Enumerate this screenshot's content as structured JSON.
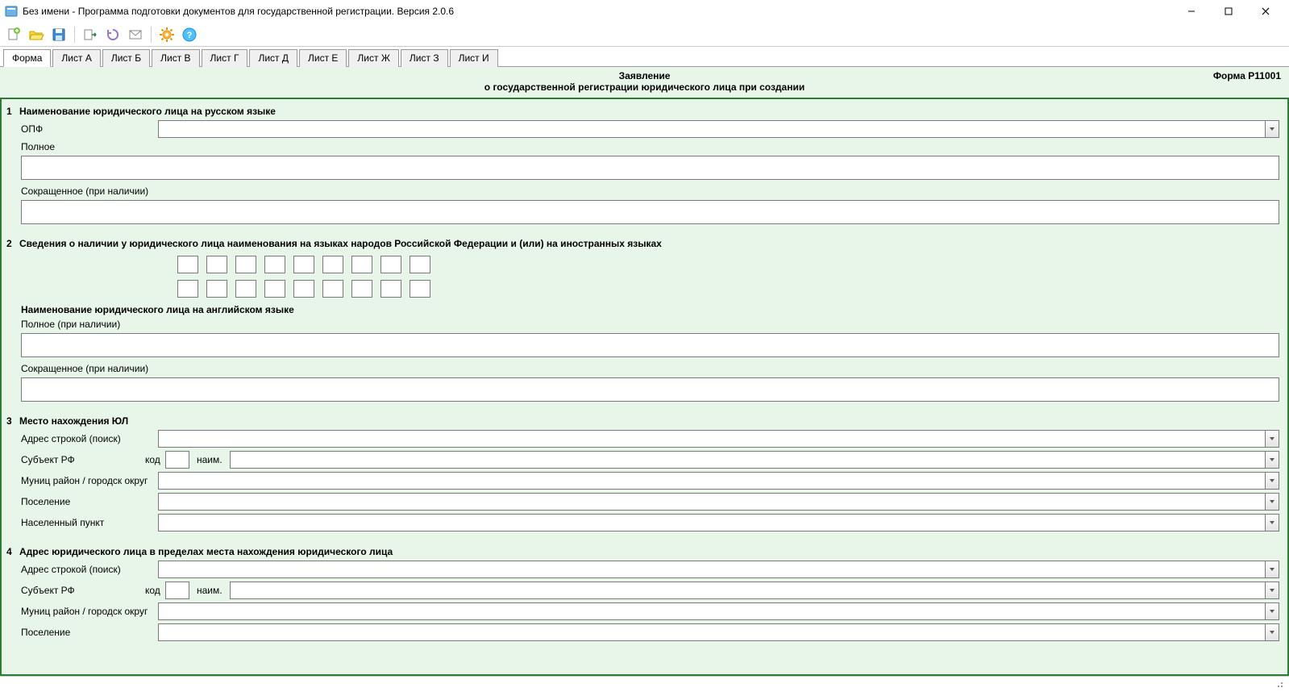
{
  "window": {
    "title": "Без имени - Программа подготовки документов для государственной регистрации. Версия 2.0.6"
  },
  "toolbar": {
    "items": [
      "new",
      "open",
      "save",
      "export",
      "refresh",
      "mail",
      "settings",
      "help"
    ]
  },
  "tabs": {
    "items": [
      {
        "label": "Форма"
      },
      {
        "label": "Лист А"
      },
      {
        "label": "Лист Б"
      },
      {
        "label": "Лист В"
      },
      {
        "label": "Лист Г"
      },
      {
        "label": "Лист Д"
      },
      {
        "label": "Лист Е"
      },
      {
        "label": "Лист Ж"
      },
      {
        "label": "Лист З"
      },
      {
        "label": "Лист И"
      }
    ],
    "active_index": 0
  },
  "form": {
    "heading1": "Заявление",
    "heading2": "о государственной регистрации юридического лица при создании",
    "code": "Форма Р11001",
    "sec1": {
      "num": "1",
      "title": "Наименование юридического лица на русском языке",
      "opf_label": "ОПФ",
      "opf_value": "",
      "full_label": "Полное",
      "full_value": "",
      "short_label": "Сокращенное (при наличии)",
      "short_value": ""
    },
    "sec2": {
      "num": "2",
      "title": "Сведения о наличии у юридического лица наименования на языках народов Российской Федерации и (или) на иностранных языках",
      "eng_title": "Наименование юридического лица на английском языке",
      "full_label": "Полное (при наличии)",
      "full_value": "",
      "short_label": "Сокращенное (при наличии)",
      "short_value": ""
    },
    "sec3": {
      "num": "3",
      "title": "Место нахождения ЮЛ",
      "addr_search_label": "Адрес строкой (поиск)",
      "subject_label": "Субъект РФ",
      "code_label": "код",
      "name_label": "наим.",
      "district_label": "Муниц район / городск округ",
      "settlement_label": "Поселение",
      "locality_label": "Населенный пункт"
    },
    "sec4": {
      "num": "4",
      "title": "Адрес юридического лица в пределах места нахождения юридического лица",
      "addr_search_label": "Адрес строкой (поиск)",
      "subject_label": "Субъект РФ",
      "code_label": "код",
      "name_label": "наим.",
      "district_label": "Муниц район / городск округ",
      "settlement_label": "Поселение"
    }
  },
  "statusbar": {
    "text": ""
  }
}
